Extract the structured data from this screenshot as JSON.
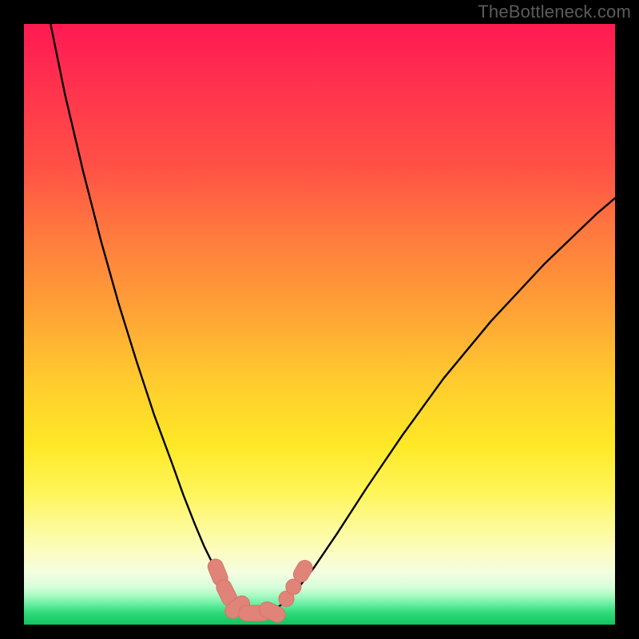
{
  "watermark": "TheBottleneck.com",
  "colors": {
    "frame": "#000000",
    "curve": "#000000",
    "marker_fill": "#e08378",
    "marker_stroke": "#d86f63",
    "gradient_top": "#ff1a52",
    "gradient_bottom": "#14c45e"
  },
  "chart_data": {
    "type": "line",
    "title": "",
    "xlabel": "",
    "ylabel": "",
    "xlim": [
      0,
      100
    ],
    "ylim": [
      0,
      100
    ],
    "grid": false,
    "legend": false,
    "note": "Axes unlabeled; values estimated from pixel positions in a 0–100 normalized coordinate space (0,0 at bottom-left of colored plot area).",
    "series": [
      {
        "name": "curve-left",
        "x": [
          4.5,
          7,
          10,
          13,
          16,
          19,
          22,
          25,
          27,
          29,
          30.5,
          32,
          33.5,
          35,
          36.5,
          38
        ],
        "y": [
          100,
          88,
          75.5,
          64,
          53.5,
          44,
          35,
          27,
          21.5,
          16.5,
          13,
          10,
          7.3,
          5.1,
          3.4,
          2.3
        ]
      },
      {
        "name": "curve-right",
        "x": [
          42,
          44,
          46,
          49,
          53,
          58,
          64,
          71,
          79,
          88,
          97,
          100
        ],
        "y": [
          2.3,
          3.6,
          5.6,
          9.4,
          15.2,
          22.8,
          31.5,
          41,
          50.5,
          60,
          68.5,
          71
        ]
      },
      {
        "name": "valley-floor",
        "x": [
          36.5,
          38,
          40,
          42,
          43.5
        ],
        "y": [
          2.1,
          1.8,
          1.7,
          1.8,
          2.1
        ]
      }
    ],
    "markers": [
      {
        "shape": "rounded-rect",
        "cx": 32.8,
        "cy": 8.7,
        "w": 2.6,
        "h": 4.6,
        "rot": -22
      },
      {
        "shape": "rounded-rect",
        "cx": 34.3,
        "cy": 5.3,
        "w": 2.6,
        "h": 4.6,
        "rot": -26
      },
      {
        "shape": "rounded-rect",
        "cx": 36.1,
        "cy": 2.9,
        "w": 4.6,
        "h": 2.6,
        "rot": -38
      },
      {
        "shape": "rounded-rect",
        "cx": 39.0,
        "cy": 1.9,
        "w": 5.4,
        "h": 2.6,
        "rot": 0
      },
      {
        "shape": "rounded-rect",
        "cx": 42.0,
        "cy": 2.1,
        "w": 4.6,
        "h": 2.6,
        "rot": 25
      },
      {
        "shape": "circle",
        "cx": 44.4,
        "cy": 4.3,
        "r": 1.3
      },
      {
        "shape": "circle",
        "cx": 45.6,
        "cy": 6.3,
        "r": 1.3
      },
      {
        "shape": "rounded-rect",
        "cx": 47.2,
        "cy": 8.9,
        "w": 2.6,
        "h": 3.8,
        "rot": 30
      }
    ]
  }
}
